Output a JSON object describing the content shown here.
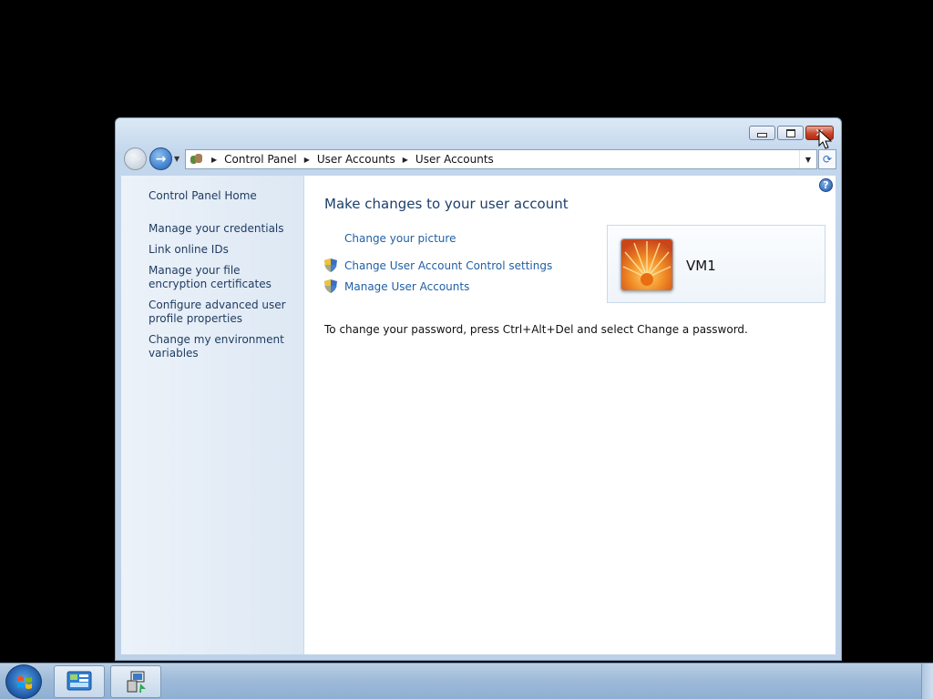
{
  "window": {
    "title_buttons": {
      "minimize": "minimize",
      "maximize": "maximize",
      "close": "close"
    }
  },
  "address": {
    "crumbs": [
      "Control Panel",
      "User Accounts",
      "User Accounts"
    ]
  },
  "sidebar": {
    "home": "Control Panel Home",
    "links": [
      "Manage your credentials",
      "Link online IDs",
      "Manage your file encryption certificates",
      "Configure advanced user profile properties",
      "Change my environment variables"
    ]
  },
  "main": {
    "title": "Make changes to your user account",
    "tasks": [
      {
        "label": "Change your picture",
        "shield": false
      },
      {
        "label": "Change User Account Control settings",
        "shield": true
      },
      {
        "label": "Manage User Accounts",
        "shield": true
      }
    ],
    "info": "To change your password, press Ctrl+Alt+Del and select Change a password.",
    "user_name": "VM1"
  },
  "taskbar": {
    "items": [
      "control-panel",
      "network-installer"
    ]
  },
  "colors": {
    "accent_link": "#1f5fa6",
    "close_button": "#c8452b",
    "desktop": "#000000"
  }
}
